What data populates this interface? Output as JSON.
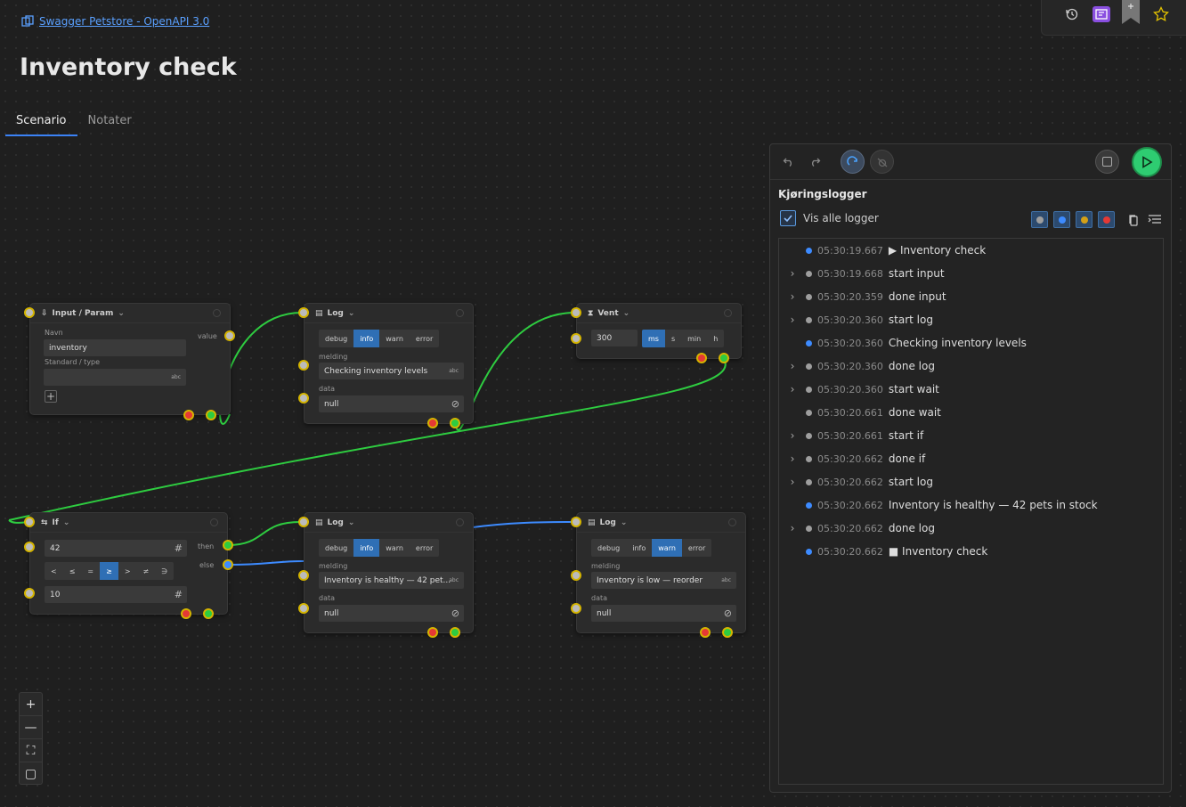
{
  "app": {
    "link_text": "Swagger Petstore - OpenAPI 3.0",
    "page_title": "Inventory check"
  },
  "tabs": [
    {
      "label": "Scenario",
      "active": true
    },
    {
      "label": "Notater",
      "active": false
    }
  ],
  "nodes": {
    "input": {
      "title": "Input / Param",
      "navn_label": "Navn",
      "navn_value": "inventory",
      "default_label": "Standard / type",
      "default_suffix": "abc",
      "value_label": "value",
      "add_glyph": "+"
    },
    "log1": {
      "title": "Log",
      "levels": [
        "debug",
        "info",
        "warn",
        "error"
      ],
      "selected": "info",
      "melding_label": "melding",
      "melding_value": "Checking inventory levels",
      "melding_suffix": "abc",
      "data_label": "data",
      "data_value": "null"
    },
    "wait": {
      "title": "Vent",
      "value": "300",
      "units": [
        "ms",
        "s",
        "min",
        "h"
      ],
      "selected": "ms"
    },
    "if": {
      "title": "If",
      "left_value": "42",
      "right_value": "10",
      "ops": [
        "<",
        "≤",
        "=",
        "≥",
        ">",
        "≠",
        "∋"
      ],
      "selected_op": "≥",
      "then_label": "then",
      "else_label": "else",
      "num_glyph": "#"
    },
    "log2": {
      "title": "Log",
      "levels": [
        "debug",
        "info",
        "warn",
        "error"
      ],
      "selected": "info",
      "melding_label": "melding",
      "melding_value": "Inventory is healthy — 42 pet...",
      "melding_suffix": "abc",
      "data_label": "data",
      "data_value": "null"
    },
    "log3": {
      "title": "Log",
      "levels": [
        "debug",
        "info",
        "warn",
        "error"
      ],
      "selected": "warn",
      "melding_label": "melding",
      "melding_value": "Inventory is low — reorder",
      "melding_suffix": "abc",
      "data_label": "data",
      "data_value": "null"
    }
  },
  "zoom": {
    "in": "+",
    "out": "—",
    "fit": "⛶",
    "map": "▢"
  },
  "panel": {
    "title": "Kjøringslogger",
    "show_all_label": "Vis alle logger",
    "show_all_checked": true,
    "filter_colors": [
      "#9e9e9e",
      "#3d8bff",
      "#d4a017",
      "#e53935"
    ],
    "logs": [
      {
        "time": "05:30:19.667",
        "text": "▶ Inventory check",
        "color": "#3d8bff",
        "expandable": false
      },
      {
        "time": "05:30:19.668",
        "text": "start input",
        "color": "#9e9e9e",
        "expandable": true
      },
      {
        "time": "05:30:20.359",
        "text": "done input",
        "color": "#9e9e9e",
        "expandable": true
      },
      {
        "time": "05:30:20.360",
        "text": "start log",
        "color": "#9e9e9e",
        "expandable": true
      },
      {
        "time": "05:30:20.360",
        "text": "Checking inventory levels",
        "color": "#3d8bff",
        "expandable": false
      },
      {
        "time": "05:30:20.360",
        "text": "done log",
        "color": "#9e9e9e",
        "expandable": true
      },
      {
        "time": "05:30:20.360",
        "text": "start wait",
        "color": "#9e9e9e",
        "expandable": true
      },
      {
        "time": "05:30:20.661",
        "text": "done wait",
        "color": "#9e9e9e",
        "expandable": false
      },
      {
        "time": "05:30:20.661",
        "text": "start if",
        "color": "#9e9e9e",
        "expandable": true
      },
      {
        "time": "05:30:20.662",
        "text": "done if",
        "color": "#9e9e9e",
        "expandable": true
      },
      {
        "time": "05:30:20.662",
        "text": "start log",
        "color": "#9e9e9e",
        "expandable": true
      },
      {
        "time": "05:30:20.662",
        "text": "Inventory is healthy — 42 pets in stock",
        "color": "#3d8bff",
        "expandable": false
      },
      {
        "time": "05:30:20.662",
        "text": "done log",
        "color": "#9e9e9e",
        "expandable": true
      },
      {
        "time": "05:30:20.662",
        "text": "■ Inventory check",
        "color": "#3d8bff",
        "expandable": false
      }
    ]
  }
}
